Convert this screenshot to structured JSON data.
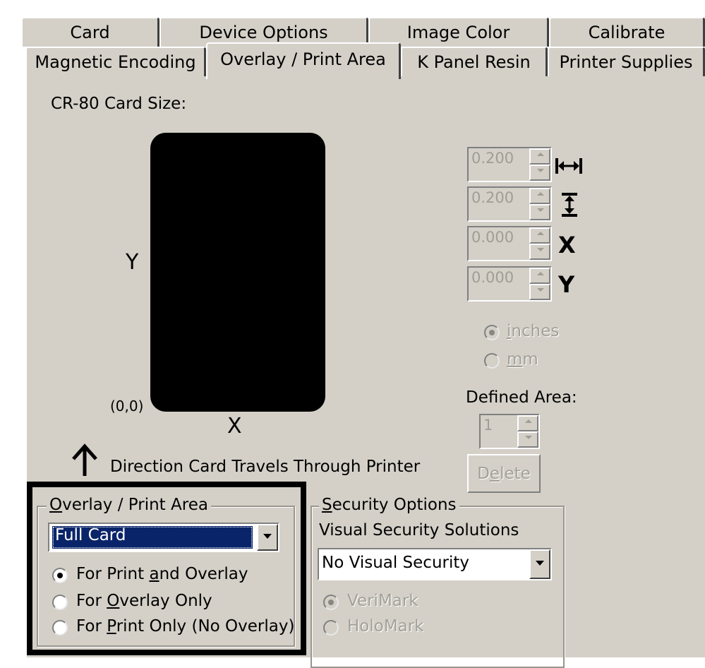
{
  "tabs": {
    "row1": [
      "Card",
      "Device Options",
      "Image Color",
      "Calibrate"
    ],
    "row2": [
      "Magnetic Encoding",
      "Overlay / Print Area",
      "K Panel Resin",
      "Printer Supplies"
    ],
    "active": "Overlay / Print Area"
  },
  "card_diagram": {
    "size_label": "CR-80 Card Size:",
    "y_label": "Y",
    "x_label": "X",
    "origin_label": "(0,0)",
    "direction_text": "Direction Card Travels Through Printer",
    "card_color": "#000000"
  },
  "dimensions": {
    "fields": [
      {
        "value": "0.200",
        "icon": "width-arrows-icon"
      },
      {
        "value": "0.200",
        "icon": "height-arrows-icon"
      },
      {
        "value": "0.000",
        "label": "X"
      },
      {
        "value": "0.000",
        "label": "Y"
      }
    ],
    "units": {
      "inches": {
        "label_pre": "",
        "accel": "i",
        "label_post": "nches"
      },
      "mm": {
        "label_pre": "",
        "accel": "m",
        "label_post": "m"
      },
      "selected": "inches"
    },
    "defined_area_label": "Defined Area:",
    "defined_area_value": "1",
    "delete": {
      "label_pre": "D",
      "accel": "e",
      "label_post": "lete"
    }
  },
  "overlay_group": {
    "legend_accel": "O",
    "legend_rest": "verlay / Print Area",
    "selected": "Full Card",
    "options": [
      {
        "pre": "For Print ",
        "accel": "a",
        "post": "nd Overlay",
        "checked": true
      },
      {
        "pre": "For ",
        "accel": "O",
        "post": "verlay Only",
        "checked": false
      },
      {
        "pre": "For ",
        "accel": "P",
        "post": "rint Only (No Overlay)",
        "checked": false
      }
    ]
  },
  "security_group": {
    "legend_accel": "S",
    "legend_rest": "ecurity Options",
    "visual_label": "Visual Security Solutions",
    "selected": "No Visual Security",
    "verimark": "VeriMark",
    "holomark": "HoloMark"
  },
  "colors": {
    "dialog_bg": "#d4d0c8",
    "selection": "#0a246a",
    "highlight_frame": "#000000"
  }
}
